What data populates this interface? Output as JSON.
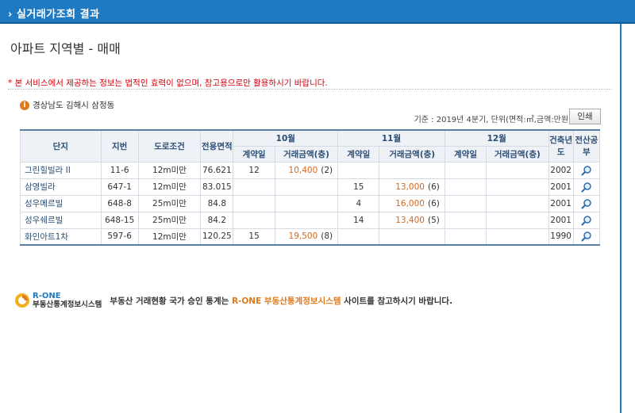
{
  "header": {
    "title": "› 실거래가조회 결과"
  },
  "page_title": "아파트 지역별 - 매매",
  "notice": "* 본 서비스에서 제공하는 정보는 법적인 효력이 없으며, 참고용으로만 활용하시기 바랍니다.",
  "location": {
    "icon": "i",
    "text": "경상남도 김해시 삼정동"
  },
  "criteria": "기준 : 2019년 4분기, 단위(면적:㎡,금액:만원)",
  "print_button": "인쇄",
  "table": {
    "headers": {
      "complex": "단지",
      "lot": "지번",
      "road": "도로조건",
      "area": "전용면적",
      "months": [
        "10월",
        "11월",
        "12월"
      ],
      "contract_day": "계약일",
      "amount": "거래금액(층)",
      "built": "건축년도",
      "register": "전산공부"
    },
    "rows": [
      {
        "name": "그린힐빌라 II",
        "lot": "11-6",
        "road": "12m미만",
        "area": "76.621",
        "m10_day": "12",
        "m10_amt": "10,400",
        "m10_floor": "(2)",
        "m11_day": "",
        "m11_amt": "",
        "m11_floor": "",
        "m12_day": "",
        "m12_amt": "",
        "m12_floor": "",
        "built": "2002"
      },
      {
        "name": "삼영빌라",
        "lot": "647-1",
        "road": "12m미만",
        "area": "83.015",
        "m10_day": "",
        "m10_amt": "",
        "m10_floor": "",
        "m11_day": "15",
        "m11_amt": "13,000",
        "m11_floor": "(6)",
        "m12_day": "",
        "m12_amt": "",
        "m12_floor": "",
        "built": "2001"
      },
      {
        "name": "성우메르빌",
        "lot": "648-8",
        "road": "25m미만",
        "area": "84.8",
        "m10_day": "",
        "m10_amt": "",
        "m10_floor": "",
        "m11_day": "4",
        "m11_amt": "16,000",
        "m11_floor": "(6)",
        "m12_day": "",
        "m12_amt": "",
        "m12_floor": "",
        "built": "2001"
      },
      {
        "name": "성우쉐르빌",
        "lot": "648-15",
        "road": "25m미만",
        "area": "84.2",
        "m10_day": "",
        "m10_amt": "",
        "m10_floor": "",
        "m11_day": "14",
        "m11_amt": "13,400",
        "m11_floor": "(5)",
        "m12_day": "",
        "m12_amt": "",
        "m12_floor": "",
        "built": "2001"
      },
      {
        "name": "화인아트1차",
        "lot": "597-6",
        "road": "12m미만",
        "area": "120.25",
        "m10_day": "15",
        "m10_amt": "19,500",
        "m10_floor": "(8)",
        "m11_day": "",
        "m11_amt": "",
        "m11_floor": "",
        "m12_day": "",
        "m12_amt": "",
        "m12_floor": "",
        "built": "1990"
      }
    ]
  },
  "rone": {
    "brand": "R-ONE",
    "sub": "부동산통계정보시스템",
    "msg_prefix": "부동산 거래현황 국가 승인 통계는 ",
    "msg_highlight": "R-ONE 부동산통계정보시스템",
    "msg_suffix": " 사이트를 참고하시기 바랍니다."
  },
  "colors": {
    "header": "#1f7ac2",
    "notice": "#d8000c",
    "amount": "#d2691e",
    "highlight": "#e07a1c"
  }
}
